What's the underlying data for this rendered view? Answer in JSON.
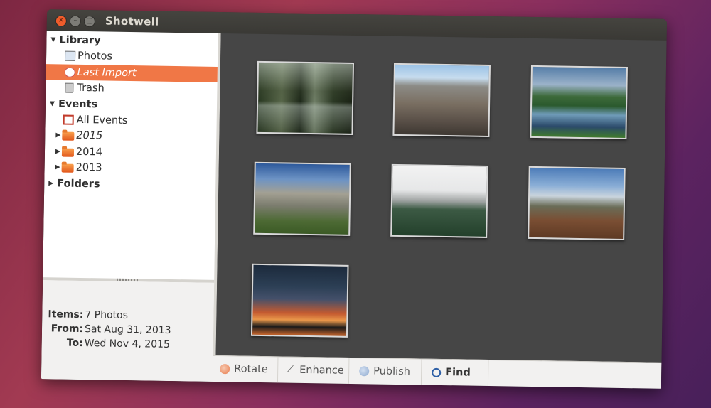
{
  "window": {
    "title": "Shotwell"
  },
  "sidebar": {
    "library_label": "Library",
    "photos_label": "Photos",
    "last_import_label": "Last Import",
    "trash_label": "Trash",
    "events_label": "Events",
    "all_events_label": "All Events",
    "years": [
      "2015",
      "2014",
      "2013"
    ],
    "folders_label": "Folders"
  },
  "info": {
    "items_key": "Items:",
    "items_value": "7 Photos",
    "from_key": "From:",
    "from_value": "Sat Aug 31, 2013",
    "to_key": "To:",
    "to_value": "Wed Nov 4, 2015"
  },
  "toolbar": {
    "rotate": "Rotate",
    "enhance": "Enhance",
    "publish": "Publish",
    "find": "Find"
  },
  "colors": {
    "selection": "#f07746",
    "viewer_bg": "#464646",
    "close_button": "#ef5c2b"
  },
  "thumbnails": [
    "forest-lake-reflection",
    "rocky-mountain-peaks",
    "green-valley-lake",
    "mountain-ridge-blue-sky",
    "foggy-forest-mesa",
    "mountain-meadow",
    "milky-way-sunset"
  ]
}
